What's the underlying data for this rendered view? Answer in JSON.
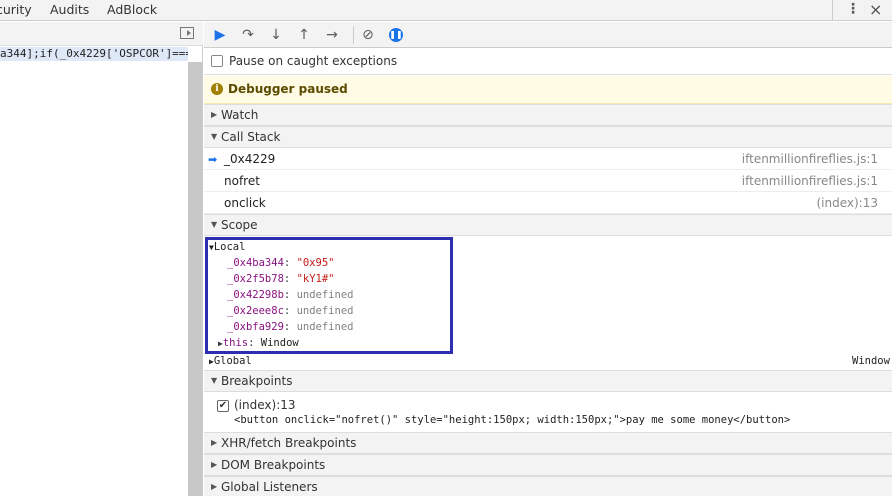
{
  "tabs": {
    "security": "curity",
    "audits": "Audits",
    "adblock": "AdBlock",
    "more_icon": "kebab-icon",
    "close_icon": "close-icon"
  },
  "source": {
    "code_line": "a344];if(_0x4229['OSPCOR']==="
  },
  "toolbar": {
    "resume_icon": "resume-icon",
    "step_over_icon": "step-over-icon",
    "step_into_icon": "step-into-icon",
    "step_out_icon": "step-out-icon",
    "step_icon": "step-icon",
    "deactivate_icon": "deactivate-breakpoints-icon",
    "pause_exceptions_icon": "pause-on-exceptions-icon",
    "accent": "#1a73e8"
  },
  "caught_exceptions": {
    "label": "Pause on caught exceptions",
    "checked": false
  },
  "banner": {
    "text": "Debugger paused",
    "icon": "info-icon",
    "background": "#fffbe5"
  },
  "sections": {
    "watch": "Watch",
    "call_stack": "Call Stack",
    "scope": "Scope",
    "breakpoints": "Breakpoints",
    "xhr": "XHR/fetch Breakpoints",
    "dom": "DOM Breakpoints",
    "global_listeners": "Global Listeners"
  },
  "call_stack": [
    {
      "name": "_0x4229",
      "location": "iftenmillionfireflies.js:1"
    },
    {
      "name": "nofret",
      "location": "iftenmillionfireflies.js:1"
    },
    {
      "name": "onclick",
      "location": "(index):13"
    }
  ],
  "scope": {
    "local_label": "Local",
    "properties": [
      {
        "name": "_0x4ba344",
        "value": "\"0x95\""
      },
      {
        "name": "_0x2f5b78",
        "value": "\"kY1#\""
      },
      {
        "name": "_0x42298b",
        "value": "undefined"
      },
      {
        "name": "_0x2eee8c",
        "value": "undefined"
      },
      {
        "name": "_0xbfa929",
        "value": "undefined"
      }
    ],
    "this_name": "this",
    "this_value": "Window",
    "global_label": "Global",
    "global_value": "Window",
    "highlight_color": "#2c2fb0"
  },
  "breakpoints": {
    "location": "(index):13",
    "code": "<button onclick=\"nofret()\" style=\"height:150px; width:150px;\">pay me some money</button>",
    "checked": true
  }
}
